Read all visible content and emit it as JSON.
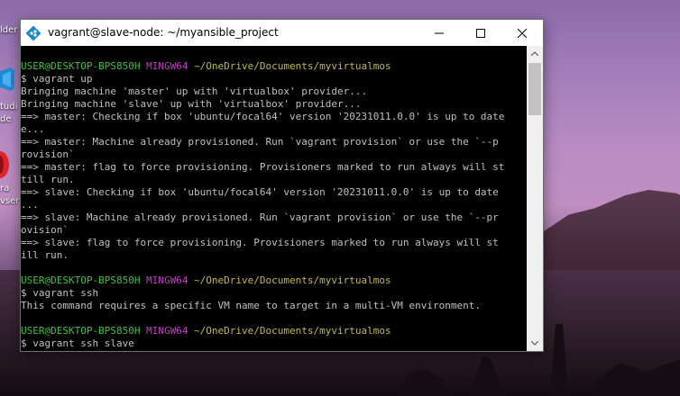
{
  "window": {
    "title": "vagrant@slave-node: ~/myansible_project",
    "minimize_label": "minimize",
    "maximize_label": "maximize",
    "close_label": "close"
  },
  "desktop": {
    "icons": [
      {
        "label": "lder",
        "icon": "folder-icon"
      },
      {
        "label": "tudi",
        "icon": "vscode-icon"
      },
      {
        "label": "de",
        "icon": ""
      },
      {
        "label": "ra",
        "icon": "opera-browser-icon"
      },
      {
        "label": "vser",
        "icon": ""
      }
    ]
  },
  "terminal": {
    "lines": [
      {
        "type": "prompt",
        "user": "USER@DESKTOP-BPS850H",
        "host": "MINGW64",
        "path": "~/OneDrive/Documents/myvirtualmos"
      },
      {
        "type": "text",
        "text": "$ vagrant up"
      },
      {
        "type": "text",
        "text": "Bringing machine 'master' up with 'virtualbox' provider..."
      },
      {
        "type": "text",
        "text": "Bringing machine 'slave' up with 'virtualbox' provider..."
      },
      {
        "type": "text",
        "text": "==> master: Checking if box 'ubuntu/focal64' version '20231011.0.0' is up to date"
      },
      {
        "type": "text",
        "text": "e..."
      },
      {
        "type": "text",
        "text": "==> master: Machine already provisioned. Run `vagrant provision` or use the `--p"
      },
      {
        "type": "text",
        "text": "rovision`"
      },
      {
        "type": "text",
        "text": "==> master: flag to force provisioning. Provisioners marked to run always will st"
      },
      {
        "type": "text",
        "text": "till run."
      },
      {
        "type": "text",
        "text": "==> slave: Checking if box 'ubuntu/focal64' version '20231011.0.0' is up to date"
      },
      {
        "type": "text",
        "text": "..."
      },
      {
        "type": "text",
        "text": "==> slave: Machine already provisioned. Run `vagrant provision` or use the `--pr"
      },
      {
        "type": "text",
        "text": "ovision`"
      },
      {
        "type": "text",
        "text": "==> slave: flag to force provisioning. Provisioners marked to run always will st"
      },
      {
        "type": "text",
        "text": "ill run."
      },
      {
        "type": "blank",
        "text": ""
      },
      {
        "type": "prompt",
        "user": "USER@DESKTOP-BPS850H",
        "host": "MINGW64",
        "path": "~/OneDrive/Documents/myvirtualmos"
      },
      {
        "type": "text",
        "text": "$ vagrant ssh"
      },
      {
        "type": "text",
        "text": "This command requires a specific VM name to target in a multi-VM environment."
      },
      {
        "type": "blank",
        "text": ""
      },
      {
        "type": "prompt",
        "user": "USER@DESKTOP-BPS850H",
        "host": "MINGW64",
        "path": "~/OneDrive/Documents/myvirtualmos"
      },
      {
        "type": "text",
        "text": "$ vagrant ssh slave"
      }
    ]
  },
  "colors": {
    "prompt_user": "#3fbf3f",
    "prompt_host": "#bf3fbf",
    "prompt_path": "#bfbf3f",
    "terminal_text": "#c0c0c0",
    "terminal_bg": "#000000"
  }
}
